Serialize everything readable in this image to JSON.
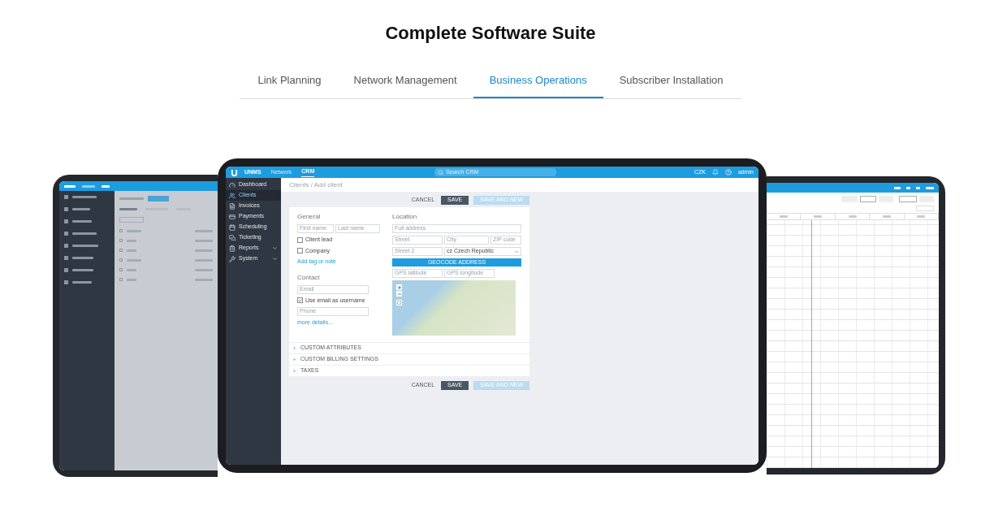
{
  "title": "Complete Software Suite",
  "tabs": [
    {
      "label": "Link Planning",
      "selected": false
    },
    {
      "label": "Network Management",
      "selected": false
    },
    {
      "label": "Business Operations",
      "selected": true
    },
    {
      "label": "Subscriber Installation",
      "selected": false
    }
  ],
  "center_app": {
    "brand": "UNMS",
    "nav": [
      {
        "label": "Network",
        "selected": false
      },
      {
        "label": "CRM",
        "selected": true
      }
    ],
    "search": {
      "placeholder": "Search CRM"
    },
    "currency": "CZK",
    "user": "admin",
    "sidebar": [
      {
        "label": "Dashboard",
        "selected": false,
        "kind": "plain"
      },
      {
        "label": "Clients",
        "selected": true,
        "kind": "plain"
      },
      {
        "label": "Invoices",
        "selected": false,
        "kind": "plain"
      },
      {
        "label": "Payments",
        "selected": false,
        "kind": "plain"
      },
      {
        "label": "Scheduling",
        "selected": false,
        "kind": "plain"
      },
      {
        "label": "Ticketing",
        "selected": false,
        "kind": "plain"
      },
      {
        "label": "Reports",
        "selected": false,
        "kind": "group"
      },
      {
        "label": "System",
        "selected": false,
        "kind": "group"
      }
    ],
    "breadcrumb": "Clients / Add client",
    "actions_top": [
      {
        "label": "CANCEL",
        "kind": "text"
      },
      {
        "label": "SAVE",
        "kind": "primary"
      },
      {
        "label": "SAVE AND NEW",
        "kind": "faded"
      }
    ],
    "general": {
      "heading": "General",
      "first_name": "First name",
      "last_name": "Last name",
      "checks": [
        {
          "label": "Client lead",
          "checked": false
        },
        {
          "label": "Company",
          "checked": false
        }
      ],
      "link": "Add tag or note"
    },
    "contact": {
      "heading": "Contact",
      "email": "Email",
      "checks": [
        {
          "label": "Use email as username",
          "checked": true
        }
      ],
      "phone": "Phone",
      "link": "more details..."
    },
    "location": {
      "heading": "Location",
      "full_address": "Full address",
      "street": "Street",
      "city": "City",
      "zip": "ZIP code",
      "street2": "Street 2",
      "country": "cz Czech Republic",
      "geocode": "GEOCODE ADDRESS",
      "latitude": "GPS latitude",
      "longitude": "GPS longitude"
    },
    "sections": [
      {
        "label": "CUSTOM ATTRIBUTES",
        "expanded": false
      },
      {
        "label": "CUSTOM BILLING SETTINGS",
        "expanded": false
      },
      {
        "label": "TAXES",
        "expanded": false
      }
    ],
    "actions_bottom": [
      {
        "label": "CANCEL",
        "kind": "text"
      },
      {
        "label": "SAVE",
        "kind": "primary"
      },
      {
        "label": "SAVE AND NEW",
        "kind": "faded"
      }
    ]
  }
}
